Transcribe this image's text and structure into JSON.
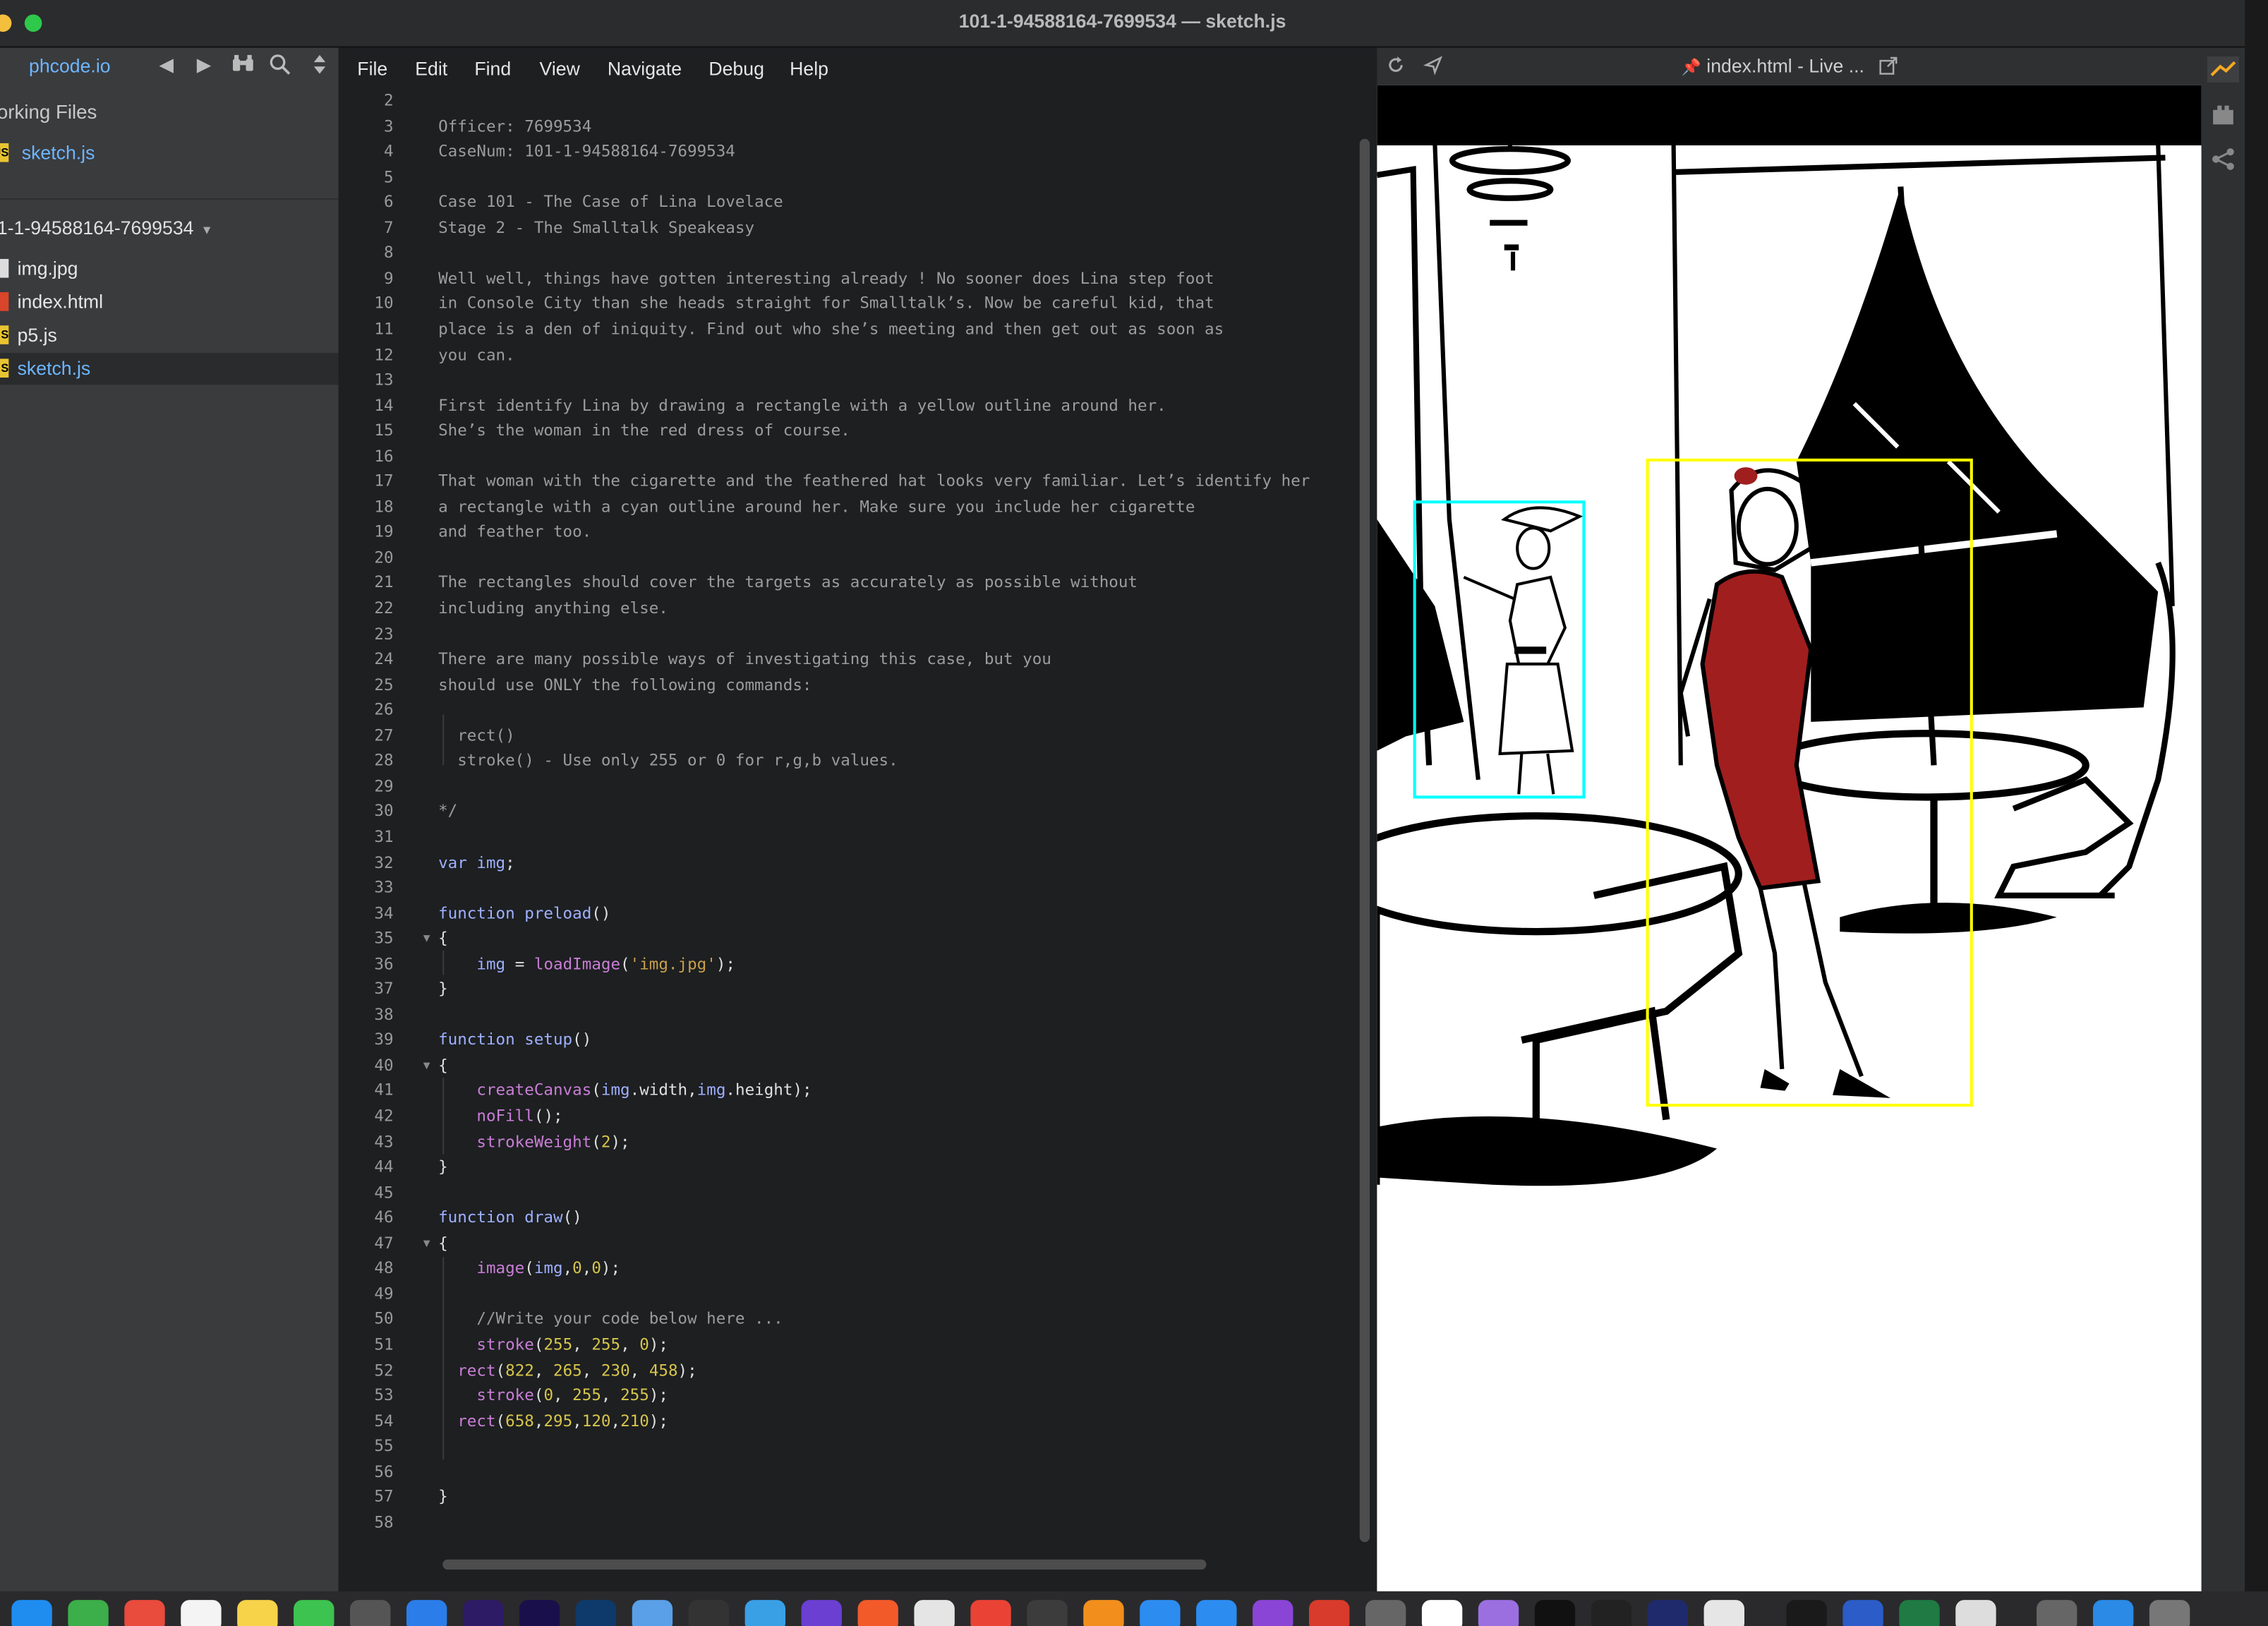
{
  "window": {
    "title": "101-1-94588164-7699534 — sketch.js"
  },
  "sidebar": {
    "brand": "phcode.io",
    "working_files_label": "orking Files",
    "working_files": [
      {
        "name": "sketch.js",
        "type": "js"
      }
    ],
    "project_label": "1-1-94588164-7699534",
    "project_caret": "▾",
    "files": [
      {
        "name": "img.jpg",
        "type": "img"
      },
      {
        "name": "index.html",
        "type": "html"
      },
      {
        "name": "p5.js",
        "type": "js"
      },
      {
        "name": "sketch.js",
        "type": "js",
        "active": true
      }
    ]
  },
  "menu": [
    "File",
    "Edit",
    "Find",
    "View",
    "Navigate",
    "Debug",
    "Help"
  ],
  "editor": {
    "first_line": 2,
    "lines": [
      "",
      "Officer: 7699534",
      "CaseNum: 101-1-94588164-7699534",
      "",
      "Case 101 - The Case of Lina Lovelace",
      "Stage 2 - The Smalltalk Speakeasy",
      "",
      "Well well, things have gotten interesting already ! No sooner does Lina step foot",
      "in Console City than she heads straight for Smalltalk’s. Now be careful kid, that",
      "place is a den of iniquity. Find out who she’s meeting and then get out as soon as",
      "you can.",
      "",
      "First identify Lina by drawing a rectangle with a yellow outline around her.",
      "She’s the woman in the red dress of course.",
      "",
      "That woman with the cigarette and the feathered hat looks very familiar. Let’s identify her",
      "a rectangle with a cyan outline around her. Make sure you include her cigarette",
      "and feather too.",
      "",
      "The rectangles should cover the targets as accurately as possible without",
      "including anything else.",
      "",
      "There are many possible ways of investigating this case, but you",
      "should use ONLY the following commands:",
      "",
      "  rect()",
      "  stroke() - Use only 255 or 0 for r,g,b values.",
      "",
      "*/",
      "",
      "var img;",
      "",
      "function preload()",
      "{",
      "    img = loadImage('img.jpg');",
      "}",
      "",
      "function setup()",
      "{",
      "    createCanvas(img.width,img.height);",
      "    noFill();",
      "    strokeWeight(2);",
      "}",
      "",
      "function draw()",
      "{",
      "    image(img,0,0);",
      "",
      "    //Write your code below here ...",
      "    stroke(255, 255, 0);",
      "  rect(822, 265, 230, 458);",
      "    stroke(0, 255, 255);",
      "  rect(658,295,120,210);",
      "",
      "",
      "}",
      ""
    ]
  },
  "preview": {
    "title": "index.html - Live ...",
    "pin_icon": "pin-icon",
    "open_external_icon": "external-link-icon"
  },
  "colors": {
    "yellow_box": "#ffff00",
    "cyan_box": "#00ffff",
    "dress_red": "#a01e1e",
    "link_blue": "#6db6ff"
  }
}
